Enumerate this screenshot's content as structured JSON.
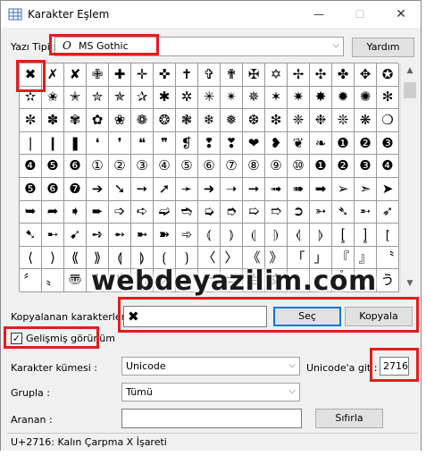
{
  "window": {
    "title": "Karakter Eşlem",
    "close_glyph": "✕",
    "min_glyph": "—",
    "max_glyph": "☐"
  },
  "font_row": {
    "label": "Yazı Tipi :",
    "font_glyph": "O",
    "font_name": "MS Gothic",
    "help_label": "Yardım"
  },
  "grid": {
    "rows": [
      [
        "✖",
        "✗",
        "✘",
        "✙",
        "✚",
        "✛",
        "✜",
        "✝",
        "✞",
        "✟",
        "✠",
        "✡",
        "✢",
        "✣",
        "✤",
        "✥",
        "✪"
      ],
      [
        "✫",
        "✬",
        "✭",
        "✮",
        "✯",
        "✰",
        "✱",
        "✲",
        "✳",
        "✴",
        "✵",
        "✶",
        "✷",
        "✸",
        "✹",
        "✺",
        "✻"
      ],
      [
        "✼",
        "✽",
        "✾",
        "✿",
        "❀",
        "❁",
        "❂",
        "❃",
        "❄",
        "❅",
        "❆",
        "❇",
        "❈",
        "❉",
        "❊",
        "❋",
        "❍"
      ],
      [
        "❘",
        "❙",
        "❚",
        "❛",
        "❜",
        "❝",
        "❞",
        "❡",
        "❢",
        "❣",
        "❤",
        "❥",
        "❦",
        "❧",
        "❶",
        "❷",
        "❸"
      ],
      [
        "❹",
        "❺",
        "❻",
        "①",
        "②",
        "③",
        "④",
        "⑤",
        "⑥",
        "⑦",
        "⑧",
        "⑨",
        "⑩",
        "❶",
        "❷",
        "❸",
        "❹"
      ],
      [
        "❺",
        "❻",
        "❼",
        "➔",
        "➘",
        "➙",
        "➚",
        "➛",
        "➜",
        "➝",
        "➞",
        "➟",
        "➠",
        "➡",
        "➢",
        "➣",
        "➤"
      ],
      [
        "➥",
        "➦",
        "➧",
        "➨",
        "➩",
        "➪",
        "➫",
        "➬",
        "➭",
        "➮",
        "➯",
        "➱",
        "➲",
        "➳",
        "➴",
        "➵",
        "➶"
      ],
      [
        "➷",
        "➸",
        "➹",
        "➺",
        "➻",
        "➼",
        "➽",
        "➾",
        "⦅",
        "⦆",
        "⦇",
        "⦈",
        "⦉",
        "⦊",
        "⦋",
        "⦌",
        "⦍"
      ],
      [
        "⟨",
        "⟩",
        "⟪",
        "⟫",
        "⟬",
        "⟭",
        "⟮",
        "⟯",
        "〈",
        "〉",
        "《",
        "》",
        "「",
        "」",
        "『",
        "』",
        "〝"
      ],
      [
        "〞",
        "〟",
        "〠",
        "〡",
        "〢",
        "〣",
        "〤",
        "〥",
        "〦",
        "〧",
        "〨",
        "〩",
        "〪",
        "〫",
        "〬",
        "〭",
        "う"
      ]
    ]
  },
  "watermark": "webdeyazilim.com",
  "copy_row": {
    "label": "Kopyalanan karakterler :",
    "value": "✖",
    "select_label": "Seç",
    "copy_label": "Kopyala"
  },
  "advanced": {
    "label": "Gelişmiş görünüm",
    "checked": "✓"
  },
  "charset_row": {
    "label": "Karakter kümesi :",
    "value": "Unicode"
  },
  "goto_row": {
    "label": "Unicode'a git :",
    "value": "2716"
  },
  "group_row": {
    "label": "Grupla :",
    "value": "Tümü"
  },
  "search_row": {
    "label": "Aranan :",
    "value": "",
    "clear_label": "Sıfırla"
  },
  "status": "U+2716: Kalın Çarpma X İşareti",
  "scroll": {
    "up": "▲",
    "down": "▼"
  }
}
